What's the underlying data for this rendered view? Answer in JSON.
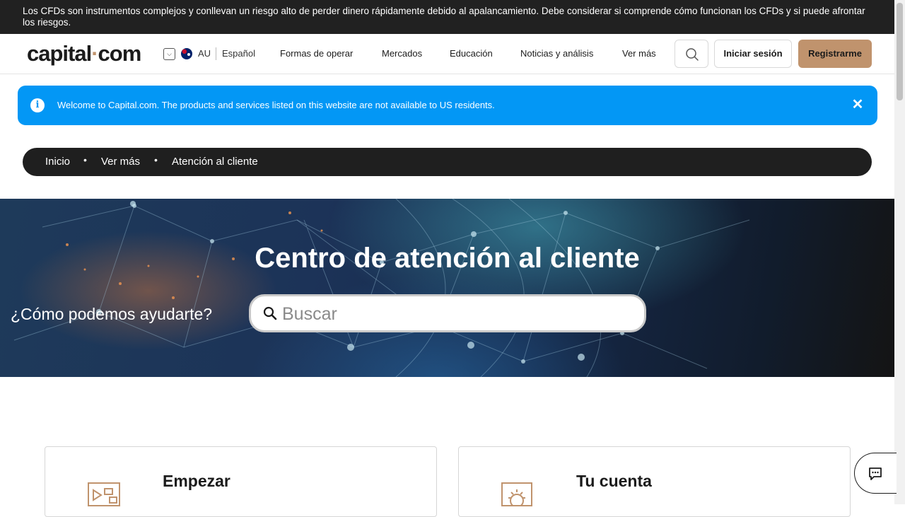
{
  "risk_warning": "Los CFDs son instrumentos complejos y conllevan un riesgo alto de perder dinero rápidamente debido al apalancamiento. Debe considerar si comprende cómo funcionan los CFDs y si puede afrontar los riesgos.",
  "header": {
    "logo_main": "capital",
    "logo_dot": "·",
    "logo_tld": "com",
    "region": "AU",
    "language": "Español",
    "nav": [
      "Formas de operar",
      "Mercados",
      "Educación",
      "Noticias y análisis",
      "Ver más"
    ],
    "login_label": "Iniciar sesión",
    "signup_label": "Registrarme"
  },
  "info_banner": {
    "text": "Welcome to Capital.com. The products and services listed on this website are not available to US residents.",
    "info_glyph": "i",
    "close_glyph": "✕"
  },
  "breadcrumb": {
    "items": [
      "Inicio",
      "Ver más",
      "Atención al cliente"
    ],
    "separator": "•"
  },
  "hero": {
    "title": "Centro de atención al cliente",
    "prompt": "¿Cómo podemos ayudarte?",
    "search_placeholder": "Buscar"
  },
  "cards": [
    {
      "title": "Empezar",
      "icon": "video-tutorial-icon"
    },
    {
      "title": "Tu cuenta",
      "icon": "account-settings-icon"
    }
  ],
  "colors": {
    "brand_accent": "#c0936d",
    "info_blue": "#0397f5",
    "dark_bar": "#212121"
  },
  "chat_icon": "chat-bubble-icon"
}
